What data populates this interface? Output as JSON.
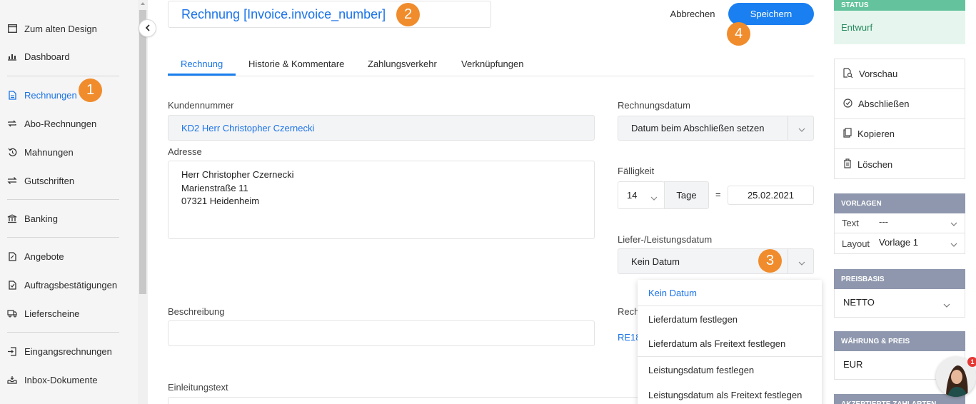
{
  "sidebar": {
    "items": [
      {
        "label": "Zum alten Design",
        "icon": "window-icon"
      },
      {
        "label": "Dashboard",
        "icon": "dashboard-icon"
      },
      {
        "label": "Rechnungen",
        "icon": "invoice-icon"
      },
      {
        "label": "Abo-Rechnungen",
        "icon": "repeat-icon"
      },
      {
        "label": "Mahnungen",
        "icon": "history-icon"
      },
      {
        "label": "Gutschriften",
        "icon": "exchange-icon"
      },
      {
        "label": "Banking",
        "icon": "bank-icon"
      },
      {
        "label": "Angebote",
        "icon": "document-icon"
      },
      {
        "label": "Auftragsbestätigungen",
        "icon": "document-icon"
      },
      {
        "label": "Lieferscheine",
        "icon": "truck-icon"
      },
      {
        "label": "Eingangsrechnungen",
        "icon": "import-icon"
      },
      {
        "label": "Inbox-Dokumente",
        "icon": "inbox-icon"
      }
    ],
    "active": "Rechnungen"
  },
  "badges": {
    "one": "1",
    "two": "2",
    "three": "3",
    "four": "4"
  },
  "header": {
    "title": "Rechnung [Invoice.invoice_number]",
    "cancel_label": "Abbrechen",
    "save_label": "Speichern"
  },
  "tabs": [
    "Rechnung",
    "Historie & Kommentare",
    "Zahlungsverkehr",
    "Verknüpfungen"
  ],
  "form": {
    "customer_label": "Kundennummer",
    "customer_value": "KD2 Herr Christopher Czernecki",
    "address_label": "Adresse",
    "address_lines": [
      "Herr Christopher Czernecki",
      "Marienstraße 11",
      "07321 Heidenheim"
    ],
    "invoice_date_label": "Rechnungsdatum",
    "invoice_date_value": "Datum beim Abschließen setzen",
    "due_label": "Fälligkeit",
    "due_days": "14",
    "due_unit": "Tage",
    "due_equals": "=",
    "due_date": "25.02.2021",
    "delivery_label": "Liefer-/Leistungsdatum",
    "delivery_value": "Kein Datum",
    "description_label": "Beschreibung",
    "intro_label": "Einleitungstext",
    "invoice_number_label_partial": "Rech",
    "invoice_number_partial": "RE18"
  },
  "delivery_menu": {
    "items": [
      "Kein Datum",
      "Lieferdatum festlegen",
      "Lieferdatum als Freitext festlegen",
      "Leistungsdatum festlegen",
      "Leistungsdatum als Freitext festlegen"
    ],
    "selected": "Kein Datum"
  },
  "right_panel": {
    "status_head": "STATUS",
    "status_value": "Entwurf",
    "actions": [
      {
        "label": "Vorschau",
        "icon": "preview-icon"
      },
      {
        "label": "Abschließen",
        "icon": "check-circle-icon"
      },
      {
        "label": "Kopieren",
        "icon": "copy-icon"
      },
      {
        "label": "Löschen",
        "icon": "trash-icon"
      }
    ],
    "templates_head": "VORLAGEN",
    "text_label": "Text",
    "text_value": "---",
    "layout_label": "Layout",
    "layout_value": "Vorlage 1",
    "price_head": "PREISBASIS",
    "price_value": "NETTO",
    "currency_head": "WÄHRUNG & PREIS",
    "currency_value": "EUR",
    "accepted_head": "AKZEPTIERTE ZAHLARTEN"
  },
  "chat": {
    "notification_count": "1"
  },
  "colors": {
    "accent": "#1a7ff0",
    "status_green": "#64c39c",
    "panel_head": "#8e97ad",
    "badge_orange": "#f08c2c"
  }
}
